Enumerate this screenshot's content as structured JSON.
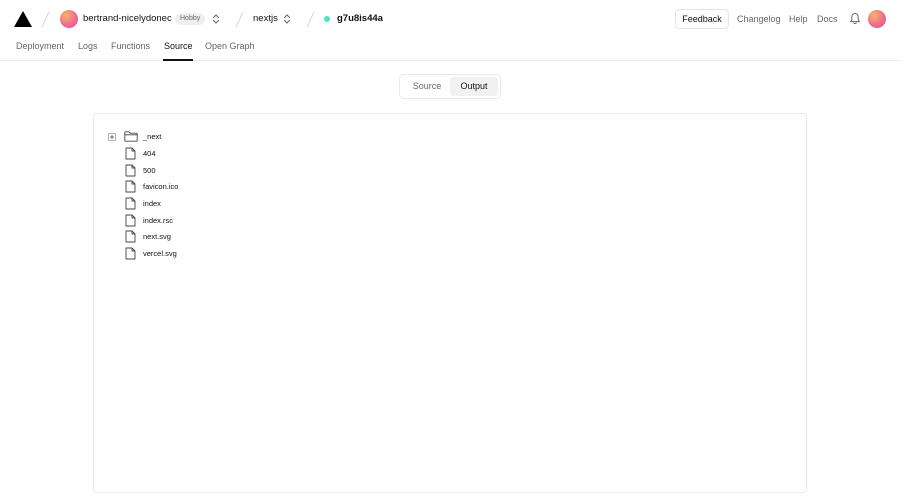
{
  "header": {
    "team": {
      "name": "bertrand-nicelydonec",
      "plan": "Hobby"
    },
    "project": {
      "name": "nextjs"
    },
    "deployment": {
      "id": "g7u8is44a",
      "status_color": "#50e3c2"
    },
    "actions": {
      "feedback_label": "Feedback",
      "links": [
        "Changelog",
        "Help",
        "Docs"
      ]
    }
  },
  "tabs": {
    "items": [
      "Deployment",
      "Logs",
      "Functions",
      "Source",
      "Open Graph"
    ],
    "active": "Source"
  },
  "view_toggle": {
    "options": [
      "Source",
      "Output"
    ],
    "selected": "Output"
  },
  "file_tree": {
    "items": [
      {
        "name": "_next",
        "type": "folder",
        "collapsed": true
      },
      {
        "name": "404",
        "type": "file"
      },
      {
        "name": "500",
        "type": "file"
      },
      {
        "name": "favicon.ico",
        "type": "file"
      },
      {
        "name": "index",
        "type": "file"
      },
      {
        "name": "index.rsc",
        "type": "file"
      },
      {
        "name": "next.svg",
        "type": "file"
      },
      {
        "name": "vercel.svg",
        "type": "file"
      }
    ]
  }
}
